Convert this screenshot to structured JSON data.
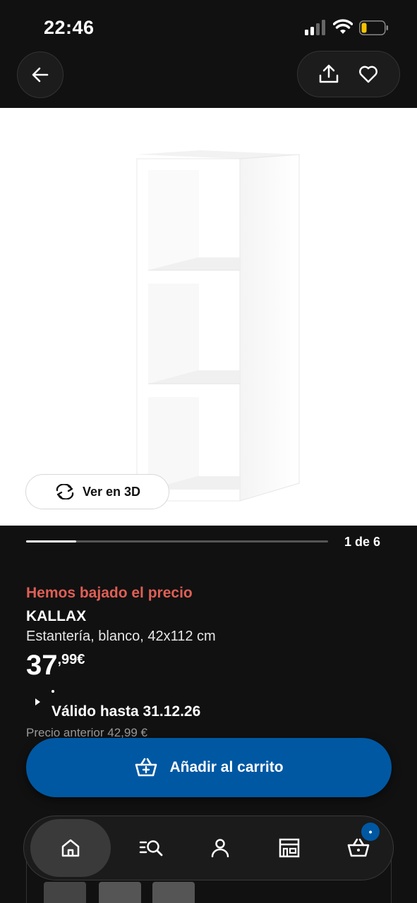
{
  "status_bar": {
    "time": "22:46"
  },
  "carousel": {
    "view_3d_label": "Ver en 3D",
    "counter": "1 de 6",
    "current": 1,
    "total": 6
  },
  "product": {
    "price_drop_label": "Hemos bajado el precio",
    "name": "KALLAX",
    "description": "Estantería, blanco, 42x112 cm",
    "price_integer": "37",
    "price_decimal": ",99€",
    "valid_until": "Válido hasta 31.12.26",
    "previous_price": "Precio anterior 42,99 €"
  },
  "cart_button": {
    "label": "Añadir al carrito"
  },
  "bottom_nav": {
    "items": [
      {
        "name": "home",
        "icon": "home-icon",
        "active": true
      },
      {
        "name": "search",
        "icon": "search-list-icon",
        "active": false
      },
      {
        "name": "profile",
        "icon": "person-icon",
        "active": false
      },
      {
        "name": "stores",
        "icon": "store-icon",
        "active": false
      },
      {
        "name": "cart",
        "icon": "basket-icon",
        "active": false
      }
    ],
    "cart_badge": "•"
  },
  "colors": {
    "accent_blue": "#0058a3",
    "price_drop_red": "#e05f56",
    "background": "#111111"
  }
}
